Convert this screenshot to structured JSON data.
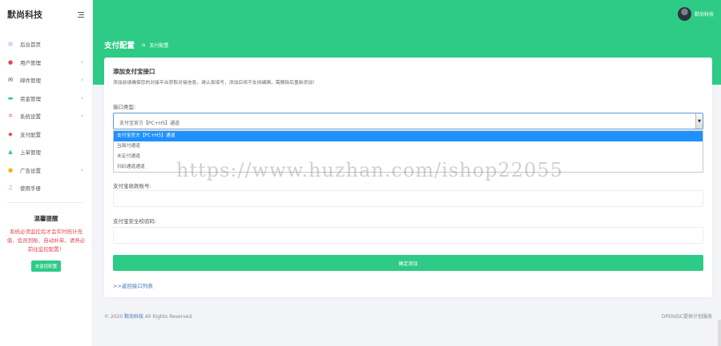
{
  "sidebar": {
    "brand": "默尚科技",
    "items": [
      {
        "label": "后台首页",
        "icon": "dashboard-icon",
        "color": "#5b8bd6",
        "arrow": false
      },
      {
        "label": "用户管理",
        "icon": "user-icon",
        "color": "#e4474e",
        "arrow": true
      },
      {
        "label": "邮件管理",
        "icon": "mail-icon",
        "color": "#333333",
        "arrow": true
      },
      {
        "label": "资金管理",
        "icon": "money-icon",
        "color": "#2ecb86",
        "arrow": true
      },
      {
        "label": "系统设置",
        "icon": "settings-icon",
        "color": "#f06fa0",
        "arrow": true
      },
      {
        "label": "支付配置",
        "icon": "payment-icon",
        "color": "#e4474e",
        "arrow": false
      },
      {
        "label": "上单管理",
        "icon": "cart-icon",
        "color": "#2ecb86",
        "arrow": false
      },
      {
        "label": "广告设置",
        "icon": "ad-icon",
        "color": "#f5b400",
        "arrow": true
      },
      {
        "label": "使用手册",
        "icon": "book-icon",
        "color": "#f06fa0",
        "arrow": false
      }
    ],
    "tip": {
      "title": "温馨提醒",
      "text": "系统必须监控后才会实时统计充值、会员到账、自动补单，请务必前往监控配置！",
      "button": "去监控配置"
    }
  },
  "topbar": {
    "user_name": "默尚科技"
  },
  "header": {
    "title": "支付配置",
    "breadcrumb": "支付配置"
  },
  "card": {
    "title": "添加支付宝接口",
    "description": "添加前请确保您的对接平台获取对接信息，请认真填写，添加后将不支持编辑，需删除后重新添加！",
    "type_label": "接口类型:",
    "selected_type": "支付宝官方【PC+H5】通道",
    "options": [
      "支付宝官方【PC+H5】通道",
      "当面付通道",
      "未定付通道",
      "扫码通道通道"
    ],
    "account_label": "支付宝收款账号:",
    "key_label": "支付宝安全校验码:",
    "submit_label": "确定添加",
    "back_link": ">>返回接口列表"
  },
  "footer": {
    "left_prefix": "© 2020",
    "left_brand": "默尚科技",
    "left_suffix": "All Rights Reserved.",
    "right": "OPENIDC提供计划服务"
  },
  "watermark": "https://www.huzhan.com/ishop22055"
}
